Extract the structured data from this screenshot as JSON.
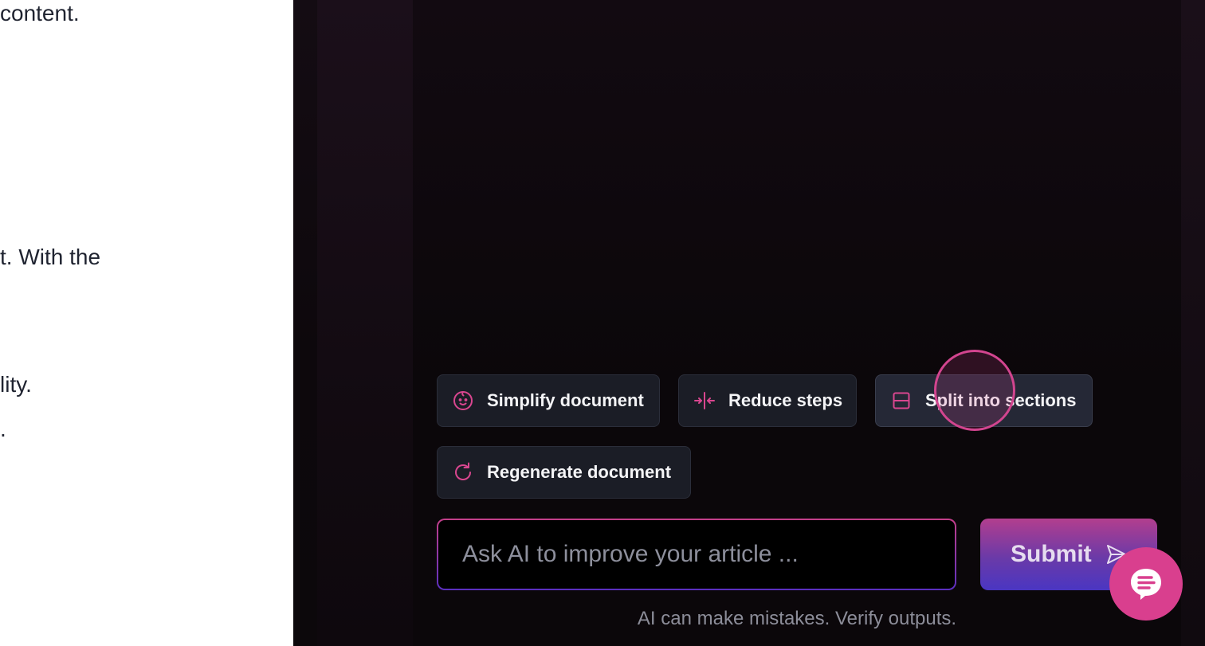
{
  "document": {
    "lines": [
      "content.",
      "t. With the",
      "lity.",
      "."
    ]
  },
  "ai_panel": {
    "actions": [
      {
        "label": "Simplify document",
        "icon": "baby-face-icon"
      },
      {
        "label": "Reduce steps",
        "icon": "compress-horizontal-icon"
      },
      {
        "label": "Split into sections",
        "icon": "split-rows-icon"
      },
      {
        "label": "Regenerate document",
        "icon": "refresh-icon"
      }
    ],
    "prompt": {
      "value": "",
      "placeholder": "Ask AI to improve your article ..."
    },
    "submit_label": "Submit",
    "disclaimer": "AI can make mistakes. Verify outputs."
  },
  "colors": {
    "accent": "#d93f8e",
    "panel_background": "#0c080b",
    "chip_background": "#1b1d26",
    "gradient_end": "#4a36c2"
  },
  "chat_widget": {
    "icon": "chat-bubble-icon"
  }
}
